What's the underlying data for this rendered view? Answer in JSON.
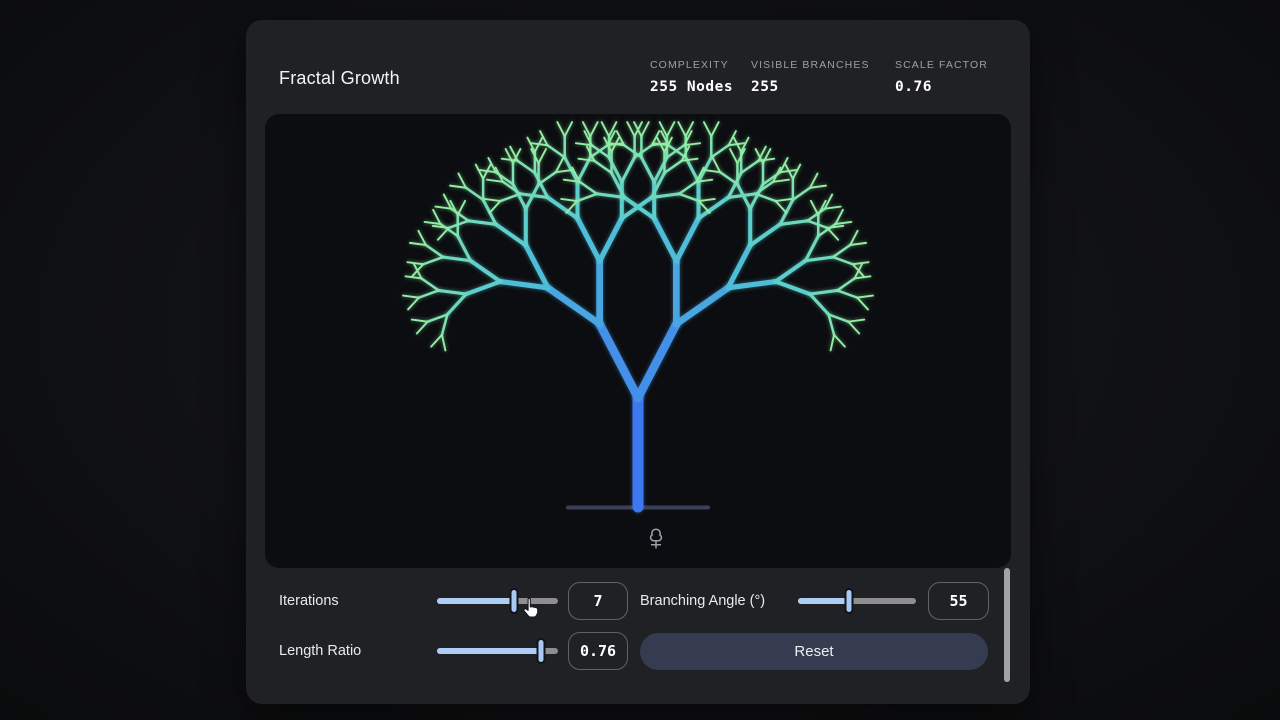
{
  "header": {
    "title": "Fractal Growth",
    "stats": [
      {
        "label": "COMPLEXITY",
        "value": "255 Nodes"
      },
      {
        "label": "VISIBLE BRANCHES",
        "value": "255"
      },
      {
        "label": "SCALE FACTOR",
        "value": "0.76"
      }
    ]
  },
  "canvas": {
    "fractal": {
      "type": "binary-fractal-tree",
      "iterations": 7,
      "branching_angle_deg": 55,
      "length_ratio": 0.76,
      "total_branches": 255,
      "trunk_color": "#3E78F0",
      "mid_color": "#52C9D4",
      "tip_color": "#93EDA4",
      "ground_color": "#3A4056",
      "glow": true
    },
    "tree_icon": "park-tree-icon",
    "tree_icon_color": "#99a0ab"
  },
  "controls": {
    "iterations": {
      "label": "Iterations",
      "value": "7",
      "slider_percent": 64
    },
    "branching_angle": {
      "label": "Branching Angle (°)",
      "value": "55",
      "slider_percent": 43
    },
    "length_ratio": {
      "label": "Length Ratio",
      "value": "0.76",
      "slider_percent": 86
    },
    "reset_label": "Reset"
  },
  "colors": {
    "card_bg": "#202124",
    "canvas_bg": "#0C0D10",
    "slider_fill": "#AECDF2",
    "slider_track": "#8E8E8E",
    "thumb": "#A9C8F2",
    "button_bg": "#353C50",
    "stat_label": "#9AA0A6"
  }
}
